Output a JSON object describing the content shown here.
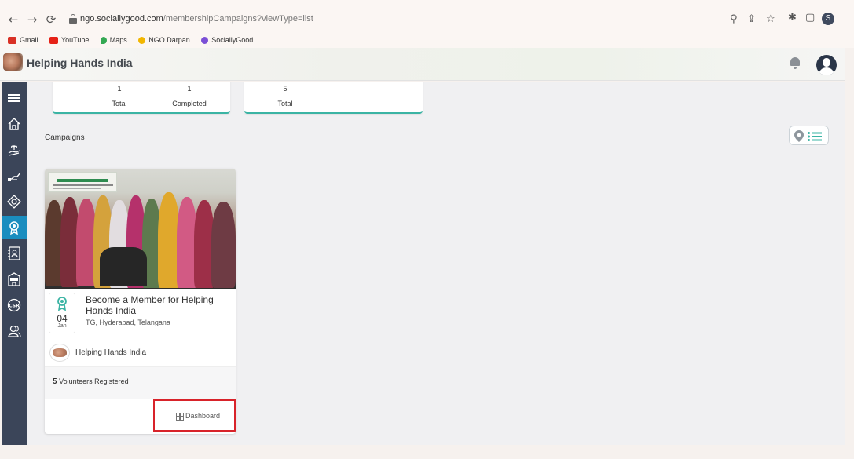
{
  "browser": {
    "url_domain": "ngo.sociallygood.com",
    "url_path": "/membershipCampaigns?viewType=list",
    "profile_initial": "S",
    "bookmarks": [
      {
        "label": "Gmail",
        "color": "#d93025"
      },
      {
        "label": "YouTube",
        "color": "#e62117"
      },
      {
        "label": "Maps",
        "color": "#34a853"
      },
      {
        "label": "NGO Darpan",
        "color": "#f2b600"
      },
      {
        "label": "SociallyGood",
        "color": "#7b4fd6"
      }
    ]
  },
  "header": {
    "org_title": "Helping Hands India",
    "icons": [
      "logo-image",
      "bell-icon",
      "user-avatar"
    ]
  },
  "sidebar": {
    "items": [
      {
        "icon": "menu-icon"
      },
      {
        "icon": "home-icon"
      },
      {
        "icon": "hand-plant-icon"
      },
      {
        "icon": "donation-icon"
      },
      {
        "icon": "badge-tag-icon"
      },
      {
        "icon": "membership-award-icon",
        "active": true
      },
      {
        "icon": "contact-book-icon"
      },
      {
        "icon": "ngo-building-icon"
      },
      {
        "icon": "csr-icon"
      },
      {
        "icon": "users-icon"
      }
    ]
  },
  "stats": {
    "card1": [
      {
        "value": "1",
        "label": "Total"
      },
      {
        "value": "1",
        "label": "Completed"
      }
    ],
    "card2": [
      {
        "value": "5",
        "label": "Total"
      }
    ]
  },
  "campaigns": {
    "section_label": "Campaigns",
    "view_toggle": [
      "map-pin-icon",
      "list-icon"
    ],
    "accent": "#3bb4a4",
    "items": [
      {
        "date_day": "04",
        "date_month": "Jan",
        "title": "Become a Member for Helping Hands India",
        "location": "TG, Hyderabad, Telangana",
        "org_name": "Helping Hands India",
        "volunteers_count": "5",
        "volunteers_label": "Volunteers Registered",
        "dashboard_label": "Dashboard"
      }
    ]
  }
}
